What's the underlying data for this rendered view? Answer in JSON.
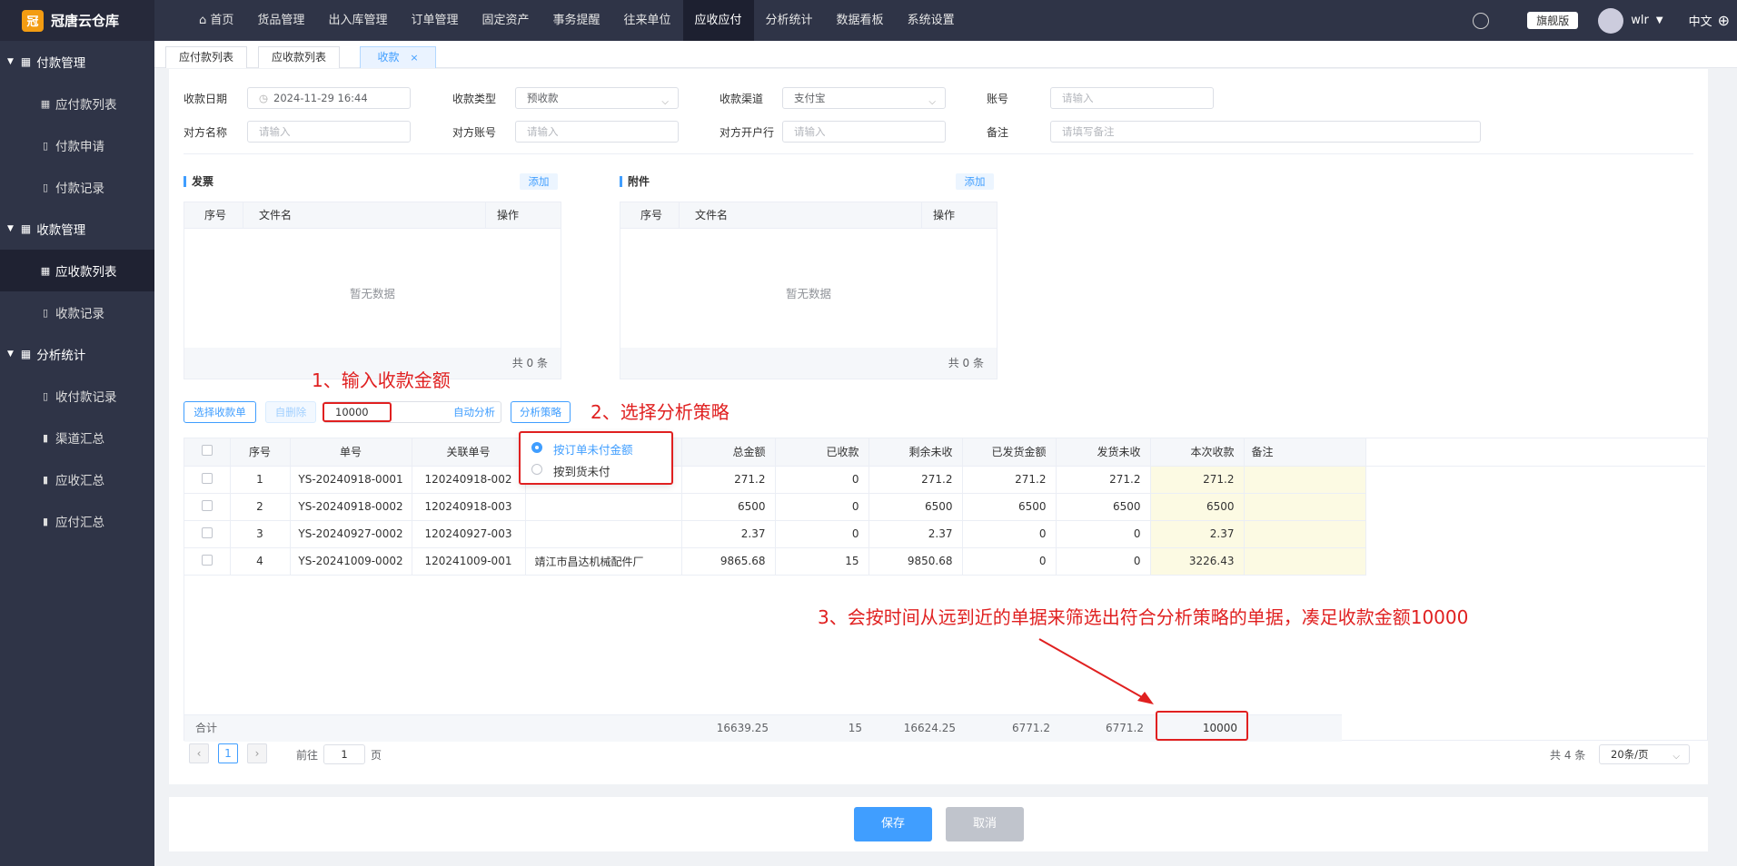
{
  "app": {
    "name": "冠唐云仓库",
    "logo_glyph": "冠"
  },
  "nav": {
    "home": "首页",
    "items": [
      "货品管理",
      "出入库管理",
      "订单管理",
      "固定资产",
      "事务提醒",
      "往来单位",
      "应收应付",
      "分析统计",
      "数据看板",
      "系统设置"
    ],
    "active": "应收应付"
  },
  "topright": {
    "edition": "旗舰版",
    "user": "wlr",
    "lang": "中文"
  },
  "sidebar": {
    "g1": "付款管理",
    "g1_items": [
      "应付款列表",
      "付款申请",
      "付款记录"
    ],
    "g2": "收款管理",
    "g2_items": [
      "应收款列表",
      "收款记录"
    ],
    "g3": "分析统计",
    "g3_items": [
      "收付款记录",
      "渠道汇总",
      "应收汇总",
      "应付汇总"
    ]
  },
  "tabs": [
    "应付款列表",
    "应收款列表",
    "收款"
  ],
  "tab_close": "×",
  "form": {
    "date_label": "收款日期",
    "date_value": "2024-11-29 16:44",
    "type_label": "收款类型",
    "type_value": "预收款",
    "channel_label": "收款渠道",
    "channel_value": "支付宝",
    "account_label": "账号",
    "account_ph": "请输入",
    "cp_name_label": "对方名称",
    "cp_name_ph": "请输入",
    "cp_account_label": "对方账号",
    "cp_account_ph": "请输入",
    "cp_bank_label": "对方开户行",
    "cp_bank_ph": "请输入",
    "remark_label": "备注",
    "remark_ph": "请填写备注"
  },
  "invoice": {
    "title": "发票",
    "add": "添加",
    "cols": [
      "序号",
      "文件名",
      "操作"
    ],
    "empty": "暂无数据",
    "footer": "共 0 条"
  },
  "attachment": {
    "title": "附件",
    "add": "添加",
    "cols": [
      "序号",
      "文件名",
      "操作"
    ],
    "empty": "暂无数据",
    "footer": "共 0 条"
  },
  "toolbar": {
    "select": "选择收款单",
    "delete": "自删除",
    "amount": "10000",
    "auto": "自动分析",
    "strategy": "分析策略"
  },
  "strategy_options": [
    "按订单未付金额",
    "按到货未付"
  ],
  "annotations": {
    "a1": "1、输入收款金额",
    "a2": "2、选择分析策略",
    "a3": "3、会按时间从远到近的单据来筛选出符合分析策略的单据，凑足收款金额10000"
  },
  "table": {
    "headers": [
      "序号",
      "单号",
      "关联单号",
      "",
      "总金额",
      "已收款",
      "剩余未收",
      "已发货金额",
      "发货未收",
      "本次收款",
      "备注"
    ],
    "rows": [
      {
        "no": "1",
        "order": "YS-20240918-0001",
        "rel": "120240918-002",
        "party": "",
        "total": "271.2",
        "received": "0",
        "remaining": "271.2",
        "shipped": "271.2",
        "ship_unpaid": "271.2",
        "this": "271.2"
      },
      {
        "no": "2",
        "order": "YS-20240918-0002",
        "rel": "120240918-003",
        "party": "",
        "total": "6500",
        "received": "0",
        "remaining": "6500",
        "shipped": "6500",
        "ship_unpaid": "6500",
        "this": "6500"
      },
      {
        "no": "3",
        "order": "YS-20240927-0002",
        "rel": "120240927-003",
        "party": "",
        "total": "2.37",
        "received": "0",
        "remaining": "2.37",
        "shipped": "0",
        "ship_unpaid": "0",
        "this": "2.37"
      },
      {
        "no": "4",
        "order": "YS-20241009-0002",
        "rel": "120241009-001",
        "party": "靖江市昌达机械配件厂",
        "total": "9865.68",
        "received": "15",
        "remaining": "9850.68",
        "shipped": "0",
        "ship_unpaid": "0",
        "this": "3226.43"
      }
    ],
    "sum": {
      "label": "合计",
      "total": "16639.25",
      "received": "15",
      "remaining": "16624.25",
      "shipped": "6771.2",
      "ship_unpaid": "6771.2",
      "this": "10000"
    }
  },
  "pager": {
    "page": "1",
    "goto_prefix": "前往",
    "goto_value": "1",
    "goto_suffix": "页",
    "total": "共 4 条",
    "size": "20条/页"
  },
  "actions": {
    "save": "保存",
    "cancel": "取消"
  },
  "colors": {
    "primary": "#409eff",
    "annotation": "#e02020",
    "sidebar": "#2f3447"
  }
}
